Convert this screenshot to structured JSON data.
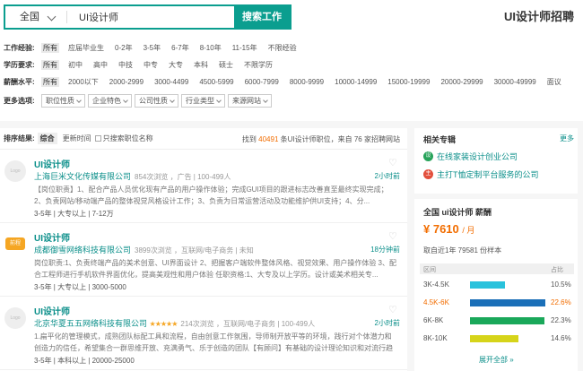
{
  "search": {
    "city": "全国",
    "keyword": "UI设计师",
    "button": "搜索工作"
  },
  "page_title": "UI设计师招聘",
  "filters": [
    {
      "label": "工作经验:",
      "options": [
        "所有",
        "应届毕业生",
        "0-2年",
        "3-5年",
        "6-7年",
        "8-10年",
        "11-15年",
        "不限经验"
      ],
      "selected": 0
    },
    {
      "label": "学历要求:",
      "options": [
        "所有",
        "初中",
        "高中",
        "中技",
        "中专",
        "大专",
        "本科",
        "硕士",
        "不限学历"
      ],
      "selected": 0
    },
    {
      "label": "薪酬水平:",
      "options": [
        "所有",
        "2000以下",
        "2000-2999",
        "3000-4499",
        "4500-5999",
        "6000-7999",
        "8000-9999",
        "10000-14999",
        "15000-19999",
        "20000-29999",
        "30000-49999",
        "面议"
      ],
      "selected": 0
    }
  ],
  "more_filters": {
    "label": "更多选项:",
    "dropdowns": [
      "职位性质",
      "企业特色",
      "公司性质",
      "行业类型",
      "来源网站"
    ]
  },
  "sortbar": {
    "label": "排序结果:",
    "comprehensive": "综合",
    "time": "更新时间",
    "company_only": "只搜索职位名称",
    "result_prefix": "找到",
    "result_count": "40491",
    "result_middle": "条UI设计师职位，来自",
    "site_count": "76",
    "result_suffix": "家招聘网站"
  },
  "jobs": [
    {
      "logo": "Logo",
      "title": "UI设计师",
      "company": "上海巨米文化传媒有限公司",
      "meta": "854次浏览 ，广告 | 100-499人",
      "stars": "",
      "ago": "2小时前",
      "desc": "【岗位职责】1、配合产品人员优化现有产品的用户操作体验；完成GUI项目的跟进标志改善直至最终实现完成；2、负责网站/移动端产品的整体视觉风格设计工作；3、负责为日常运营活动及功能维护供UI支持；4、分...",
      "req": "3-5年 | 大专以上 | 7-12万"
    },
    {
      "logo": "前程",
      "title": "UI设计师",
      "company": "成都御雪网络科技有限公司",
      "meta": "3899次浏览 ，互联网/电子商务 | 未知",
      "stars": "",
      "ago": "18分钟前",
      "desc": "岗位职责:1、负责终端产品的美术创意、UI界面设计 2、把握客户端软件整体风格、视觉效果、用户操作体验 3、配合工程师进行手机软件界面优化，提高美观性和用户体验 任职资格:1、大专及以上学历。设计或美术相关专...",
      "req": "3-5年 | 大专以上 | 3000-5000"
    },
    {
      "logo": "Logo",
      "title": "UI设计师",
      "company": "北京华夏五五网络科技有限公司",
      "meta": "214次浏览 ，互联网/电子商务 | 100-499人",
      "stars": "★★★★★",
      "ago": "2小时前",
      "desc": "1.扁平化的管理模式，成熟团队标配工具和流程，自由创意工作氛围，导师制开放平等的环境，践行对个体潜力和创造力的信任，希望集合一群思维开放、充满勇气、乐于创造的团队【有顾问】有基础的设计理论知识和对流行趋势敏锐...",
      "req": "3-5年 | 本科以上 | 20000-25000"
    }
  ],
  "topics": {
    "title": "相关专辑",
    "more": "更多",
    "items": [
      {
        "icon": "设",
        "label": "在线家装设计创业公司",
        "color": "#27a35a"
      },
      {
        "icon": "主",
        "label": "主打T恤定制平台服务的公司",
        "color": "#e24f3c"
      }
    ]
  },
  "salary": {
    "title": "全国 ui设计师 薪酬",
    "value": "¥ 7610",
    "unit": "/ 月",
    "sample": "取自近1年 79581 份样本",
    "col_range": "区间",
    "col_pct": "占比",
    "rows": [
      {
        "range": "3K-4.5K",
        "pct": "10.5%",
        "value": 10.5,
        "color": "#29c2dc",
        "highlight": false
      },
      {
        "range": "4.5K-6K",
        "pct": "22.6%",
        "value": 22.6,
        "color": "#1a6fb8",
        "highlight": true
      },
      {
        "range": "6K-8K",
        "pct": "22.3%",
        "value": 22.3,
        "color": "#1aa85a",
        "highlight": false
      },
      {
        "range": "8K-10K",
        "pct": "14.6%",
        "value": 14.6,
        "color": "#d6d41a",
        "highlight": false
      }
    ],
    "show_all": "展开全部 »"
  }
}
